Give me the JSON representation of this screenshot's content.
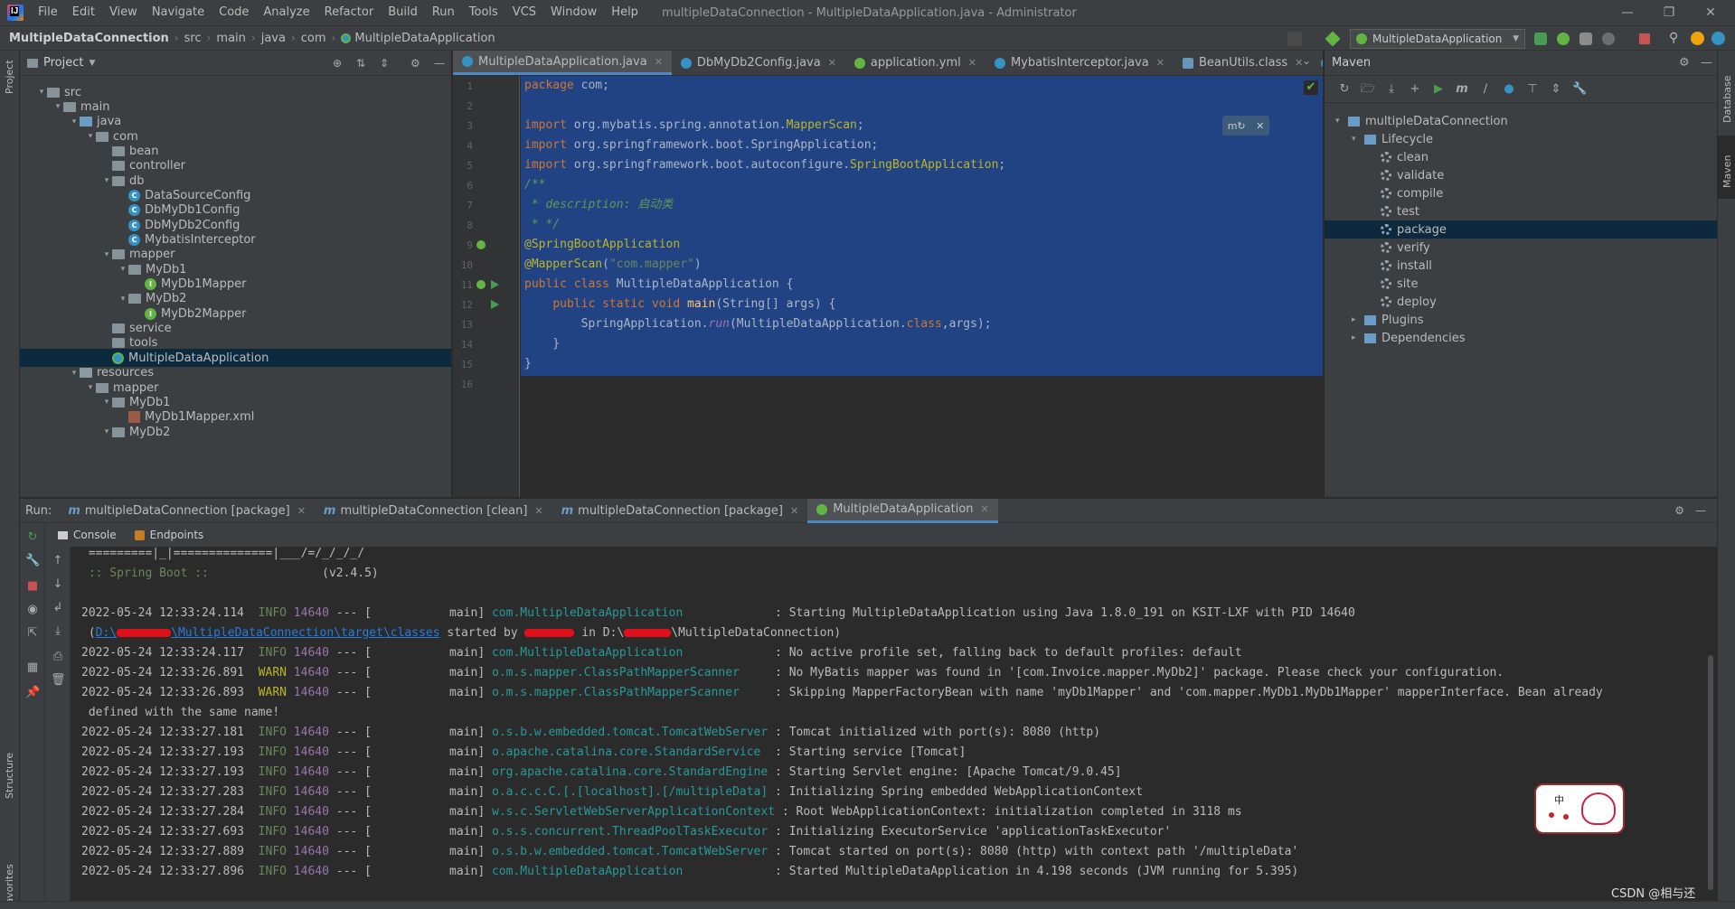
{
  "menubar": {
    "items": [
      "File",
      "Edit",
      "View",
      "Navigate",
      "Code",
      "Analyze",
      "Refactor",
      "Build",
      "Run",
      "Tools",
      "VCS",
      "Window",
      "Help"
    ],
    "window_title": "multipleDataConnection - MultipleDataApplication.java - Administrator"
  },
  "navbar": {
    "breadcrumbs": [
      "MultipleDataConnection",
      "src",
      "main",
      "java",
      "com",
      "MultipleDataApplication"
    ],
    "run_config": "MultipleDataApplication"
  },
  "left_stripe": {
    "project": "Project",
    "structure": "Structure",
    "favorites": "Favorites"
  },
  "right_stripe": {
    "database": "Database",
    "maven": "Maven"
  },
  "project": {
    "title": "Project",
    "tree": [
      {
        "label": "src",
        "type": "folder",
        "indent": 1,
        "expanded": true
      },
      {
        "label": "main",
        "type": "folder",
        "indent": 2,
        "expanded": true
      },
      {
        "label": "java",
        "type": "folder-blue",
        "indent": 3,
        "expanded": true
      },
      {
        "label": "com",
        "type": "folder",
        "indent": 4,
        "expanded": true
      },
      {
        "label": "bean",
        "type": "folder",
        "indent": 5
      },
      {
        "label": "controller",
        "type": "folder",
        "indent": 5
      },
      {
        "label": "db",
        "type": "folder",
        "indent": 5,
        "expanded": true
      },
      {
        "label": "DataSourceConfig",
        "type": "class",
        "indent": 6
      },
      {
        "label": "DbMyDb1Config",
        "type": "class",
        "indent": 6
      },
      {
        "label": "DbMyDb2Config",
        "type": "class",
        "indent": 6
      },
      {
        "label": "MybatisInterceptor",
        "type": "class",
        "indent": 6
      },
      {
        "label": "mapper",
        "type": "folder",
        "indent": 5,
        "expanded": true
      },
      {
        "label": "MyDb1",
        "type": "folder",
        "indent": 6,
        "expanded": true
      },
      {
        "label": "MyDb1Mapper",
        "type": "interface",
        "indent": 7
      },
      {
        "label": "MyDb2",
        "type": "folder",
        "indent": 6,
        "expanded": true
      },
      {
        "label": "MyDb2Mapper",
        "type": "interface",
        "indent": 7
      },
      {
        "label": "service",
        "type": "folder",
        "indent": 5
      },
      {
        "label": "tools",
        "type": "folder",
        "indent": 5
      },
      {
        "label": "MultipleDataApplication",
        "type": "spring",
        "indent": 5,
        "selected": true
      },
      {
        "label": "resources",
        "type": "folder-res",
        "indent": 3,
        "expanded": true
      },
      {
        "label": "mapper",
        "type": "folder",
        "indent": 4,
        "expanded": true
      },
      {
        "label": "MyDb1",
        "type": "folder",
        "indent": 5,
        "expanded": true
      },
      {
        "label": "MyDb1Mapper.xml",
        "type": "xml",
        "indent": 6
      },
      {
        "label": "MyDb2",
        "type": "folder",
        "indent": 5,
        "expanded": true
      }
    ]
  },
  "editor": {
    "tabs": [
      {
        "label": "MultipleDataApplication.java",
        "active": true
      },
      {
        "label": "DbMyDb2Config.java"
      },
      {
        "label": "application.yml"
      },
      {
        "label": "MybatisInterceptor.java"
      },
      {
        "label": "BeanUtils.class"
      },
      {
        "label": "DataSourc"
      }
    ],
    "line_numbers": [
      "1",
      "2",
      "3",
      "4",
      "5",
      "6",
      "7",
      "8",
      "9",
      "10",
      "11",
      "12",
      "13",
      "14",
      "15",
      "16"
    ],
    "lines": [
      [
        [
          "kw",
          "package "
        ],
        [
          "cls",
          "com;"
        ]
      ],
      [],
      [
        [
          "kw",
          "import "
        ],
        [
          "cls",
          "org.mybatis.spring.annotation."
        ],
        [
          "ann",
          "MapperScan"
        ],
        [
          "cls",
          ";"
        ]
      ],
      [
        [
          "kw",
          "import "
        ],
        [
          "cls",
          "org.springframework.boot.SpringApplication;"
        ]
      ],
      [
        [
          "kw",
          "import "
        ],
        [
          "cls",
          "org.springframework.boot.autoconfigure."
        ],
        [
          "ann",
          "SpringBootApplication"
        ],
        [
          "cls",
          ";"
        ]
      ],
      [
        [
          "doc",
          "/**"
        ]
      ],
      [
        [
          "doc",
          " * description: "
        ],
        [
          "doc",
          "启动类"
        ]
      ],
      [
        [
          "doc",
          " * */"
        ]
      ],
      [
        [
          "ann",
          "@SpringBootApplication"
        ]
      ],
      [
        [
          "ann",
          "@MapperScan"
        ],
        [
          "cls",
          "("
        ],
        [
          "str",
          "\"com.mapper\""
        ],
        [
          "cls",
          ")"
        ]
      ],
      [
        [
          "kw",
          "public class "
        ],
        [
          "cls",
          "MultipleDataApplication {"
        ]
      ],
      [
        [
          "cls",
          "    "
        ],
        [
          "kw",
          "public static void "
        ],
        [
          "fn",
          "main"
        ],
        [
          "cls",
          "(String[] args) {"
        ]
      ],
      [
        [
          "cls",
          "        SpringApplication."
        ],
        [
          "pur",
          "run"
        ],
        [
          "cls",
          "(MultipleDataApplication."
        ],
        [
          "kw",
          "class"
        ],
        [
          "cls",
          ",args);"
        ]
      ],
      [
        [
          "cls",
          "    }"
        ]
      ],
      [
        [
          "cls",
          "}"
        ]
      ],
      []
    ]
  },
  "maven": {
    "title": "Maven",
    "tree": [
      {
        "label": "multipleDataConnection",
        "indent": 0,
        "icon": "module",
        "expanded": true
      },
      {
        "label": "Lifecycle",
        "indent": 1,
        "icon": "folder",
        "expanded": true
      },
      {
        "label": "clean",
        "indent": 2,
        "icon": "gear"
      },
      {
        "label": "validate",
        "indent": 2,
        "icon": "gear"
      },
      {
        "label": "compile",
        "indent": 2,
        "icon": "gear"
      },
      {
        "label": "test",
        "indent": 2,
        "icon": "gear"
      },
      {
        "label": "package",
        "indent": 2,
        "icon": "gear",
        "selected": true
      },
      {
        "label": "verify",
        "indent": 2,
        "icon": "gear"
      },
      {
        "label": "install",
        "indent": 2,
        "icon": "gear"
      },
      {
        "label": "site",
        "indent": 2,
        "icon": "gear"
      },
      {
        "label": "deploy",
        "indent": 2,
        "icon": "gear"
      },
      {
        "label": "Plugins",
        "indent": 1,
        "icon": "folder",
        "collapsed": true
      },
      {
        "label": "Dependencies",
        "indent": 1,
        "icon": "folder",
        "collapsed": true
      }
    ]
  },
  "run": {
    "label": "Run:",
    "tabs": [
      {
        "label": "multipleDataConnection [package]"
      },
      {
        "label": "multipleDataConnection [clean]"
      },
      {
        "label": "multipleDataConnection [package]"
      },
      {
        "label": "MultipleDataApplication",
        "active": true
      }
    ],
    "subtabs": [
      "Console",
      "Endpoints"
    ],
    "console_lines": [
      [
        [
          "plain",
          " =========|_|==============|___/=/_/_/_/"
        ]
      ],
      [
        [
          "info",
          " :: Spring Boot ::"
        ],
        [
          "plain",
          "                (v2.4.5)"
        ]
      ],
      [],
      [
        [
          "plain",
          "2022-05-24 12:33:24.114  "
        ],
        [
          "info",
          "INFO"
        ],
        [
          "pid",
          " 14640"
        ],
        [
          "plain",
          " --- [           main] "
        ],
        [
          "logger",
          "com.MultipleDataApplication"
        ],
        [
          "plain",
          "             : Starting MultipleDataApplication using Java 1.8.0_191 on KSIT-LXF with PID 14640"
        ]
      ],
      [
        [
          "plain",
          " ("
        ],
        [
          "link",
          "D:\\"
        ],
        [
          "redact",
          "60"
        ],
        [
          "link",
          "\\MultipleDataConnection\\target\\classes"
        ],
        [
          "plain",
          " started by "
        ],
        [
          "redact",
          "55"
        ],
        [
          "plain",
          " in D:\\"
        ],
        [
          "redact",
          "52"
        ],
        [
          "plain",
          "\\MultipleDataConnection)"
        ]
      ],
      [
        [
          "plain",
          "2022-05-24 12:33:24.117  "
        ],
        [
          "info",
          "INFO"
        ],
        [
          "pid",
          " 14640"
        ],
        [
          "plain",
          " --- [           main] "
        ],
        [
          "logger",
          "com.MultipleDataApplication"
        ],
        [
          "plain",
          "             : No active profile set, falling back to default profiles: default"
        ]
      ],
      [
        [
          "plain",
          "2022-05-24 12:33:26.891  "
        ],
        [
          "warn",
          "WARN"
        ],
        [
          "pid",
          " 14640"
        ],
        [
          "plain",
          " --- [           main] "
        ],
        [
          "logger",
          "o.m.s.mapper.ClassPathMapperScanner"
        ],
        [
          "plain",
          "     : No MyBatis mapper was found in '[com.Invoice.mapper.MyDb2]' package. Please check your configuration."
        ]
      ],
      [
        [
          "plain",
          "2022-05-24 12:33:26.893  "
        ],
        [
          "warn",
          "WARN"
        ],
        [
          "pid",
          " 14640"
        ],
        [
          "plain",
          " --- [           main] "
        ],
        [
          "logger",
          "o.m.s.mapper.ClassPathMapperScanner"
        ],
        [
          "plain",
          "     : Skipping MapperFactoryBean with name 'myDb1Mapper' and 'com.mapper.MyDb1.MyDb1Mapper' mapperInterface. Bean already"
        ]
      ],
      [
        [
          "plain",
          " defined with the same name!"
        ]
      ],
      [
        [
          "plain",
          "2022-05-24 12:33:27.181  "
        ],
        [
          "info",
          "INFO"
        ],
        [
          "pid",
          " 14640"
        ],
        [
          "plain",
          " --- [           main] "
        ],
        [
          "logger",
          "o.s.b.w.embedded.tomcat.TomcatWebServer"
        ],
        [
          "plain",
          " : Tomcat initialized with port(s): 8080 (http)"
        ]
      ],
      [
        [
          "plain",
          "2022-05-24 12:33:27.193  "
        ],
        [
          "info",
          "INFO"
        ],
        [
          "pid",
          " 14640"
        ],
        [
          "plain",
          " --- [           main] "
        ],
        [
          "logger",
          "o.apache.catalina.core.StandardService"
        ],
        [
          "plain",
          "  : Starting service [Tomcat]"
        ]
      ],
      [
        [
          "plain",
          "2022-05-24 12:33:27.193  "
        ],
        [
          "info",
          "INFO"
        ],
        [
          "pid",
          " 14640"
        ],
        [
          "plain",
          " --- [           main] "
        ],
        [
          "logger",
          "org.apache.catalina.core.StandardEngine"
        ],
        [
          "plain",
          " : Starting Servlet engine: [Apache Tomcat/9.0.45]"
        ]
      ],
      [
        [
          "plain",
          "2022-05-24 12:33:27.283  "
        ],
        [
          "info",
          "INFO"
        ],
        [
          "pid",
          " 14640"
        ],
        [
          "plain",
          " --- [           main] "
        ],
        [
          "logger",
          "o.a.c.c.C.[.[localhost].[/multipleData]"
        ],
        [
          "plain",
          " : Initializing Spring embedded WebApplicationContext"
        ]
      ],
      [
        [
          "plain",
          "2022-05-24 12:33:27.284  "
        ],
        [
          "info",
          "INFO"
        ],
        [
          "pid",
          " 14640"
        ],
        [
          "plain",
          " --- [           main] "
        ],
        [
          "logger",
          "w.s.c.ServletWebServerApplicationContext"
        ],
        [
          "plain",
          " : Root WebApplicationContext: initialization completed in 3118 ms"
        ]
      ],
      [
        [
          "plain",
          "2022-05-24 12:33:27.693  "
        ],
        [
          "info",
          "INFO"
        ],
        [
          "pid",
          " 14640"
        ],
        [
          "plain",
          " --- [           main] "
        ],
        [
          "logger",
          "o.s.s.concurrent.ThreadPoolTaskExecutor"
        ],
        [
          "plain",
          " : Initializing ExecutorService 'applicationTaskExecutor'"
        ]
      ],
      [
        [
          "plain",
          "2022-05-24 12:33:27.889  "
        ],
        [
          "info",
          "INFO"
        ],
        [
          "pid",
          " 14640"
        ],
        [
          "plain",
          " --- [           main] "
        ],
        [
          "logger",
          "o.s.b.w.embedded.tomcat.TomcatWebServer"
        ],
        [
          "plain",
          " : Tomcat started on port(s): 8080 (http) with context path '/multipleData'"
        ]
      ],
      [
        [
          "plain",
          "2022-05-24 12:33:27.896  "
        ],
        [
          "info",
          "INFO"
        ],
        [
          "pid",
          " 14640"
        ],
        [
          "plain",
          " --- [           main] "
        ],
        [
          "logger",
          "com.MultipleDataApplication"
        ],
        [
          "plain",
          "             : Started MultipleDataApplication in 4.198 seconds (JVM running for 5.395)"
        ]
      ]
    ]
  },
  "watermark": "CSDN @相与还",
  "sticker_text": "中"
}
